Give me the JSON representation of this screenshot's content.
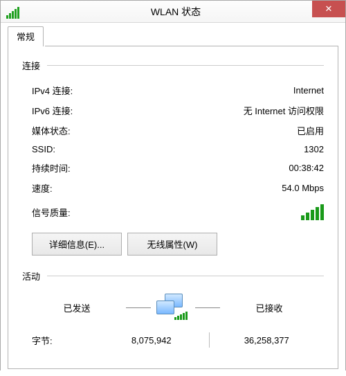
{
  "title": "WLAN 状态",
  "tab": {
    "general": "常规"
  },
  "connection": {
    "header": "连接",
    "ipv4_label": "IPv4 连接:",
    "ipv4_value": "Internet",
    "ipv6_label": "IPv6 连接:",
    "ipv6_value": "无 Internet 访问权限",
    "media_label": "媒体状态:",
    "media_value": "已启用",
    "ssid_label": "SSID:",
    "ssid_value": "1302",
    "duration_label": "持续时间:",
    "duration_value": "00:38:42",
    "speed_label": "速度:",
    "speed_value": "54.0 Mbps",
    "signal_label": "信号质量:"
  },
  "buttons": {
    "details": "详细信息(E)...",
    "wireless_props": "无线属性(W)"
  },
  "activity": {
    "header": "活动",
    "sent_label": "已发送",
    "received_label": "已接收",
    "bytes_label": "字节:",
    "bytes_sent": "8,075,942",
    "bytes_received": "36,258,377"
  }
}
